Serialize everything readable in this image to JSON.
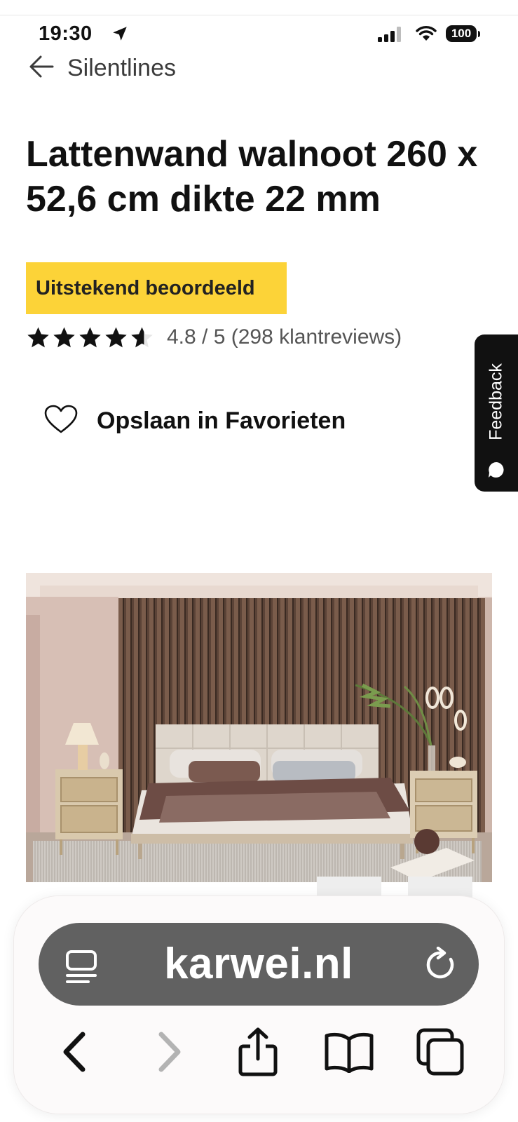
{
  "status_bar": {
    "time": "19:30",
    "battery": "100",
    "icons": [
      "location-arrow-icon",
      "cellular-signal-icon",
      "wifi-icon",
      "battery-icon"
    ]
  },
  "nav": {
    "back_label": "Silentlines",
    "back_icon": "arrow-left-icon"
  },
  "product": {
    "title": "Lattenwand walnoot 260 x 52,6 cm dikte 22 mm",
    "badge": "Uitstekend beoordeeld",
    "rating_value": 4.8,
    "rating_text": "4.8 / 5 (298 klantreviews)",
    "favorite_label": "Opslaan in Favorieten",
    "favorite_icon": "heart-outline-icon"
  },
  "feedback_tab": {
    "label": "Feedback",
    "icon": "chat-bubble-icon"
  },
  "browser": {
    "url": "karwei.nl",
    "icons": [
      "reader-mode-icon",
      "reload-icon",
      "back-chevron-icon",
      "forward-chevron-icon",
      "share-icon",
      "bookmarks-icon",
      "tabs-icon"
    ]
  },
  "colors": {
    "badge_bg": "#fcd338",
    "feedback_bg": "#111111",
    "url_bar_bg": "#616161",
    "star": "#111111"
  }
}
